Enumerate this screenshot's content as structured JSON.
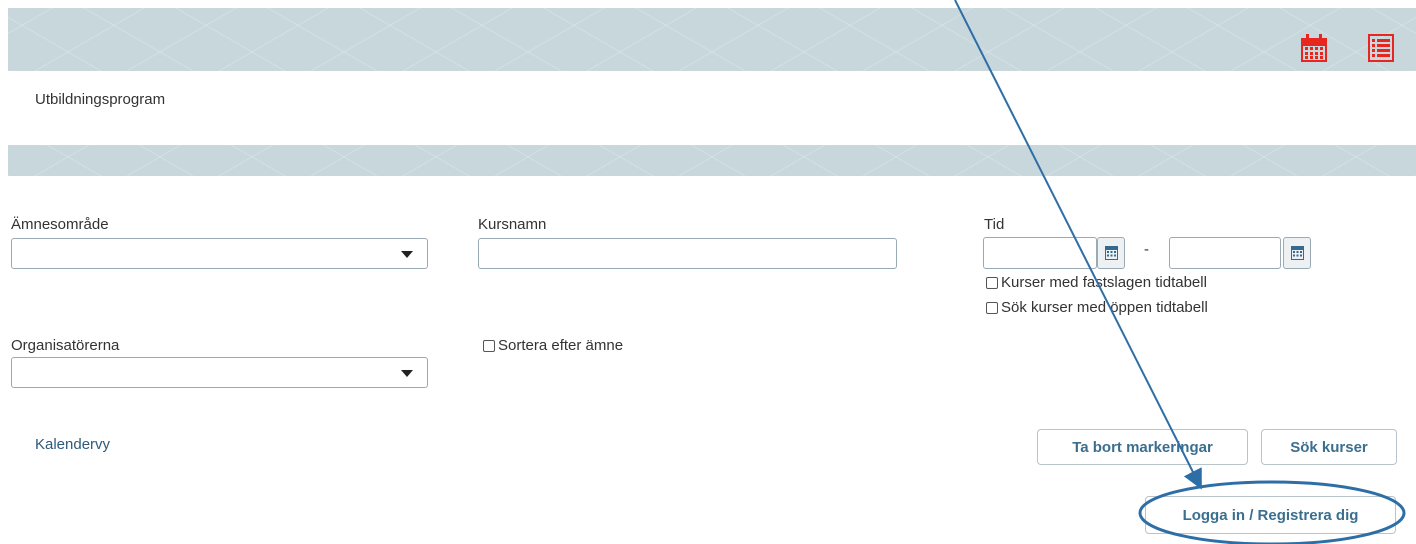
{
  "header": {
    "calendar_icon": "calendar-icon",
    "list_icon": "list-icon",
    "icon_color": "#e8261f"
  },
  "page": {
    "title": "Utbildningsprogram"
  },
  "filters": {
    "subject_area": {
      "label": "Ämnesområde",
      "value": ""
    },
    "course_name": {
      "label": "Kursnamn",
      "value": ""
    },
    "time": {
      "label": "Tid",
      "from": "",
      "separator": "-",
      "to": "",
      "fixed_schedule_label": "Kurser med fastslagen tidtabell",
      "open_schedule_label": "Sök kurser med öppen tidtabell"
    },
    "organizers": {
      "label": "Organisatörerna",
      "value": ""
    },
    "sort_by_subject_label": "Sortera efter ämne"
  },
  "actions": {
    "calendar_view_link": "Kalendervy",
    "clear_label": "Ta bort markeringar",
    "search_label": "Sök kurser",
    "login_label": "Logga in / Registrera dig"
  },
  "annotation": {
    "color": "#2e6ea6"
  }
}
